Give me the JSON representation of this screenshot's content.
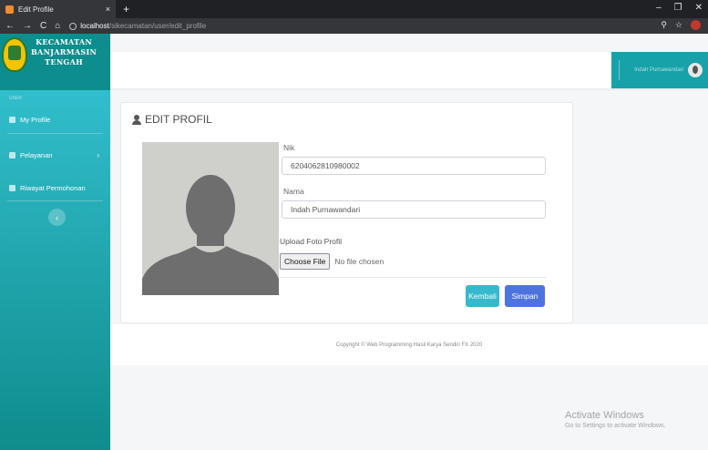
{
  "browser": {
    "tab_title": "Edit Profile",
    "tab_close": "×",
    "new_tab": "+",
    "url_host": "localhost",
    "url_path": "/sikecamatan/user/edit_profile",
    "nav": {
      "back": "←",
      "forward": "→",
      "reload": "C",
      "home": "⌂"
    },
    "window": {
      "minimize": "–",
      "maximize": "❐",
      "close": "✕"
    },
    "addr_icons": {
      "zoom": "⚲",
      "star": "☆"
    }
  },
  "brand": {
    "line1": "KECAMATAN",
    "line2": "BANJARMASIN",
    "line3": "TENGAH"
  },
  "sidebar": {
    "section_label": "USER",
    "items": [
      {
        "label": "My Profile",
        "icon": "user-icon"
      },
      {
        "label": "Pelayanan",
        "icon": "list-icon",
        "chevron": "›"
      },
      {
        "label": "Riwayat Permohonan",
        "icon": "history-icon"
      }
    ],
    "collapse": "‹"
  },
  "topbar": {
    "user_name": "Indah Purnawandari"
  },
  "card": {
    "title": "EDIT PROFIL",
    "fields": {
      "nik_label": "Nik",
      "nik_value": "6204062810980002",
      "nama_label": "Nama",
      "nama_value": "Indah Purnawandari",
      "upload_label": "Upload Foto Profil",
      "file_button": "Choose File",
      "file_status": "No file chosen"
    },
    "buttons": {
      "back": "Kembali",
      "save": "Simpan"
    }
  },
  "footer": {
    "copyright": "Copyright © Web Programming Hasil Karya Sendiri FX 2020"
  },
  "watermark": {
    "line1": "Activate Windows",
    "line2": "Go to Settings to activate Windows."
  },
  "colors": {
    "sidebar_top": "#35c3d3",
    "sidebar_bottom": "#0f8c8c",
    "primary": "#4e73df",
    "info": "#36b9cc"
  }
}
